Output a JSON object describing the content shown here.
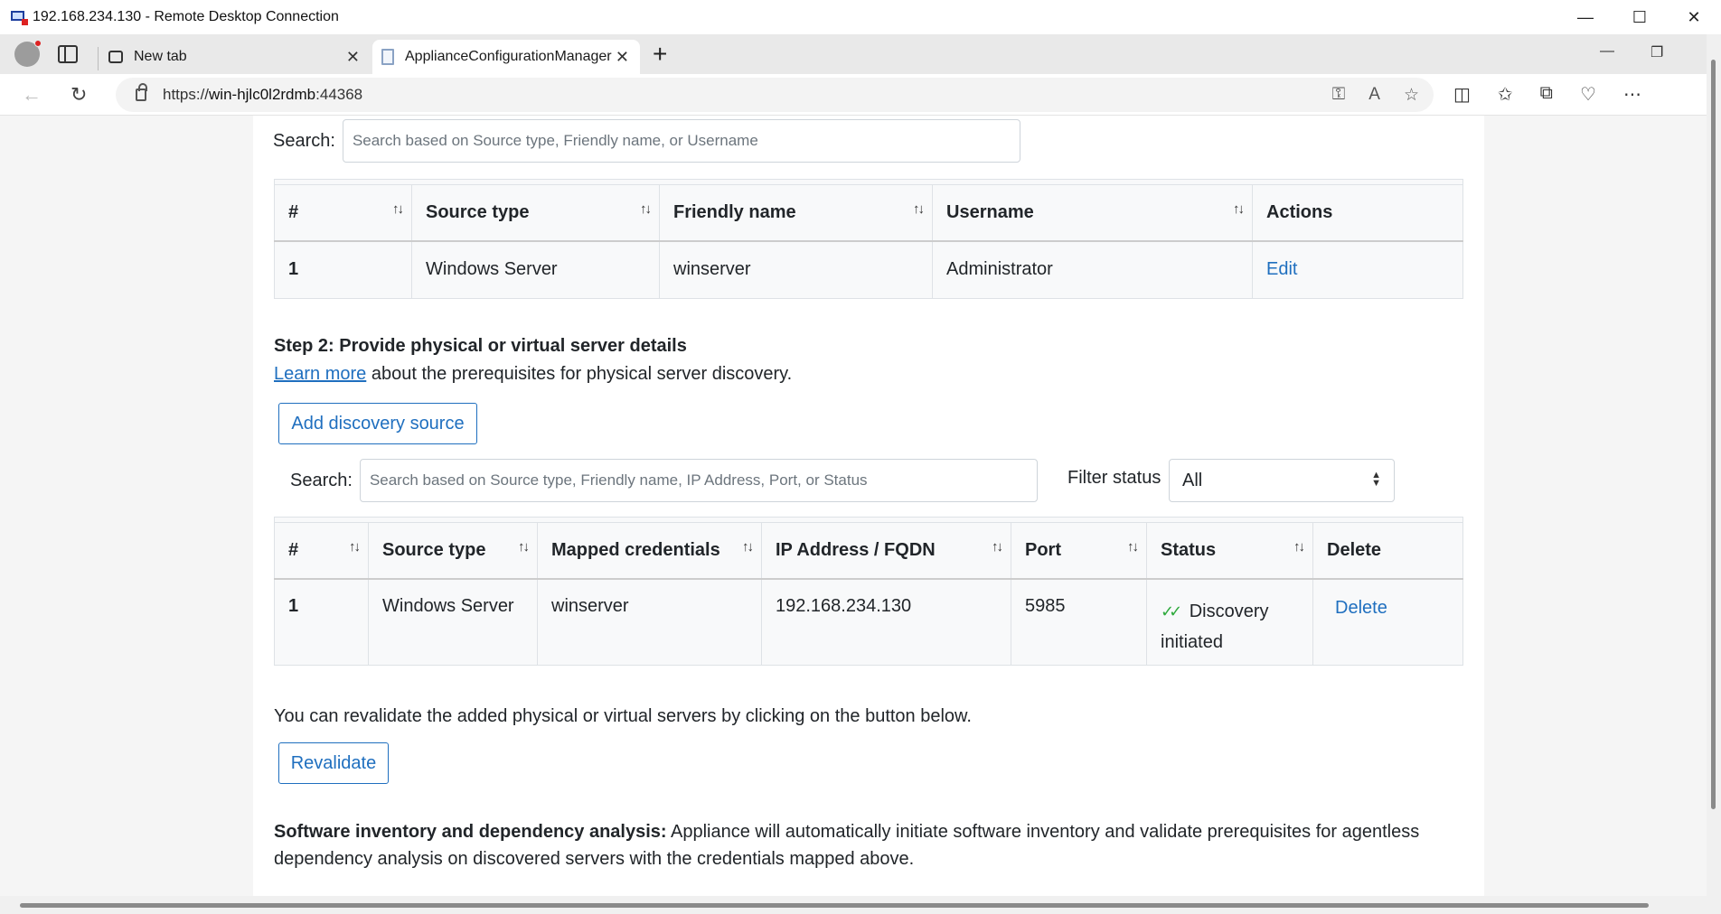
{
  "window": {
    "title": "192.168.234.130 - Remote Desktop Connection",
    "minimize": "—",
    "maximize": "☐",
    "close": "✕"
  },
  "browser": {
    "tabs": [
      {
        "label": "New tab",
        "close": "✕"
      },
      {
        "label": "ApplianceConfigurationManager",
        "close": "✕"
      }
    ],
    "new_tab": "+",
    "url_scheme": "https://",
    "url_host": "win-hjlc0l2rdmb",
    "url_port": ":44368"
  },
  "credentials_section": {
    "search_label": "Search:",
    "search_placeholder": "Search based on Source type, Friendly name, or Username",
    "columns": [
      "#",
      "Source type",
      "Friendly name",
      "Username",
      "Actions"
    ],
    "rows": [
      {
        "num": "1",
        "source_type": "Windows Server",
        "friendly_name": "winserver",
        "username": "Administrator",
        "action": "Edit"
      }
    ]
  },
  "step2": {
    "heading": "Step 2: Provide physical or virtual server details",
    "learn_more_link": "Learn more",
    "learn_more_rest": " about the prerequisites for physical server discovery.",
    "add_button": "Add discovery source",
    "search_label": "Search:",
    "search_placeholder": "Search based on Source type, Friendly name, IP Address, Port, or Status",
    "filter_label": "Filter status",
    "filter_value": "All",
    "columns": [
      "#",
      "Source type",
      "Mapped credentials",
      "IP Address / FQDN",
      "Port",
      "Status",
      "Delete"
    ],
    "rows": [
      {
        "num": "1",
        "source_type": "Windows Server",
        "mapped_credentials": "winserver",
        "ip": "192.168.234.130",
        "port": "5985",
        "status_line1": "Discovery",
        "status_line2": "initiated",
        "delete": "Delete"
      }
    ]
  },
  "revalidate": {
    "text": "You can revalidate the added physical or virtual servers by clicking on the button below.",
    "button": "Revalidate"
  },
  "software_inventory": {
    "bold": "Software inventory and dependency analysis:",
    "text": " Appliance will automatically initiate software inventory and validate prerequisites for agentless dependency analysis on discovered servers with the credentials mapped above."
  },
  "colors": {
    "link": "#1f6fbf",
    "success_check": "#2eaa3c"
  }
}
